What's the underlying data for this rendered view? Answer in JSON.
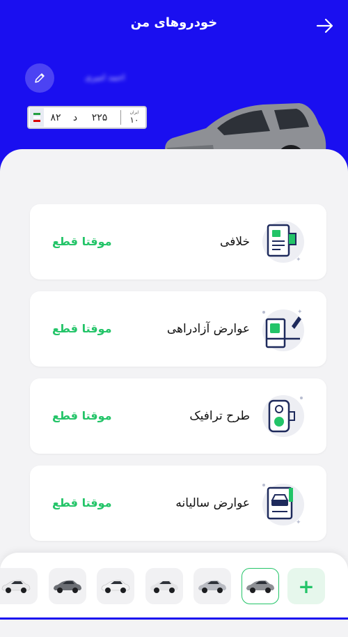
{
  "header": {
    "title": "خودروهای من"
  },
  "owner": {
    "name": "احمد امیری"
  },
  "plate": {
    "region_label": "ایران",
    "region": "۱۰",
    "number": "۲۲۵",
    "letter": "د",
    "prefix": "۸۲"
  },
  "services": [
    {
      "title": "خلافی",
      "status": "موقتا قطع",
      "icon": "fines-receipt-icon"
    },
    {
      "title": "عوارض آزادراهی",
      "status": "موقتا قطع",
      "icon": "toll-booth-icon"
    },
    {
      "title": "طرح ترافیک",
      "status": "موقتا قطع",
      "icon": "traffic-plan-icon"
    },
    {
      "title": "عوارض سالیانه",
      "status": "موقتا قطع",
      "icon": "annual-toll-icon"
    }
  ],
  "car_list": {
    "add_label": "+",
    "count": 7,
    "selected_index": 0
  },
  "colors": {
    "primary": "#1a0ff0",
    "accent": "#23c468",
    "icon_navy": "#1e2a5c"
  }
}
